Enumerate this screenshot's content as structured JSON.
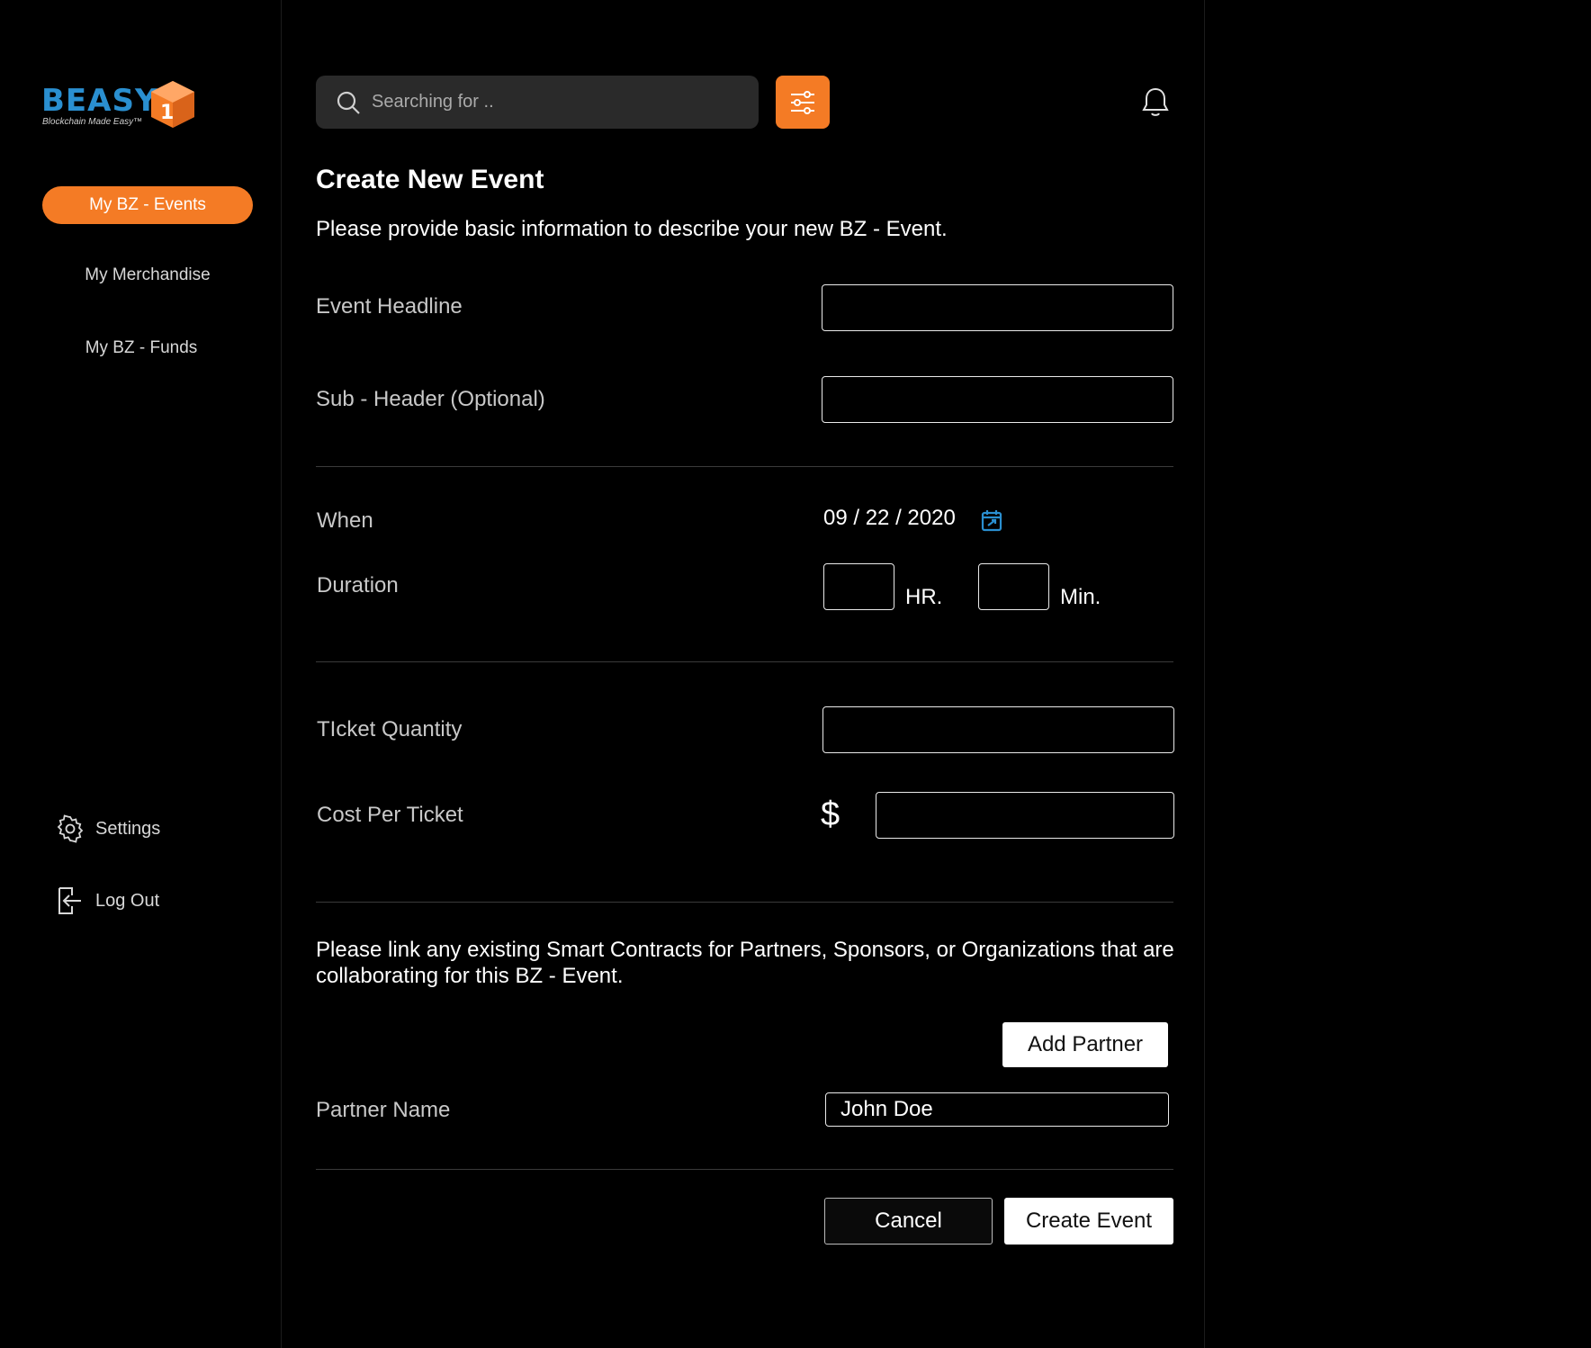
{
  "brand": {
    "name": "BEASY",
    "tagline": "Blockchain Made Easy™",
    "cube_glyph": "1"
  },
  "sidebar": {
    "items": [
      {
        "label": "My BZ - Events",
        "active": true
      },
      {
        "label": "My Merchandise",
        "active": false
      },
      {
        "label": "My BZ - Funds",
        "active": false
      }
    ],
    "settings_label": "Settings",
    "logout_label": "Log Out"
  },
  "search": {
    "placeholder": "Searching for .."
  },
  "colors": {
    "accent": "#f47b25",
    "brand_blue": "#2a8fd0",
    "background": "#000000"
  },
  "icons": {
    "search": "search-icon",
    "filter": "sliders-icon",
    "notifications": "bell-icon",
    "calendar": "calendar-icon",
    "settings": "gear-icon",
    "logout": "logout-icon"
  },
  "form": {
    "title": "Create New Event",
    "subtitle": "Please provide basic information to describe your new BZ - Event.",
    "headline_label": "Event Headline",
    "subheader_label": "Sub - Header (Optional)",
    "when_label": "When",
    "date_value": "09 / 22 / 2020",
    "duration_label": "Duration",
    "hr_unit": "HR.",
    "min_unit": "Min.",
    "ticket_qty_label": "TIcket Quantity",
    "cost_label": "Cost Per Ticket",
    "currency_symbol": "$",
    "partners_text": "Please link any existing Smart Contracts for Partners, Sponsors, or Organizations that are collaborating for this BZ - Event.",
    "add_partner_label": "Add Partner",
    "partner_name_label": "Partner Name",
    "partner_name_value": "John Doe",
    "cancel_label": "Cancel",
    "create_label": "Create Event"
  }
}
